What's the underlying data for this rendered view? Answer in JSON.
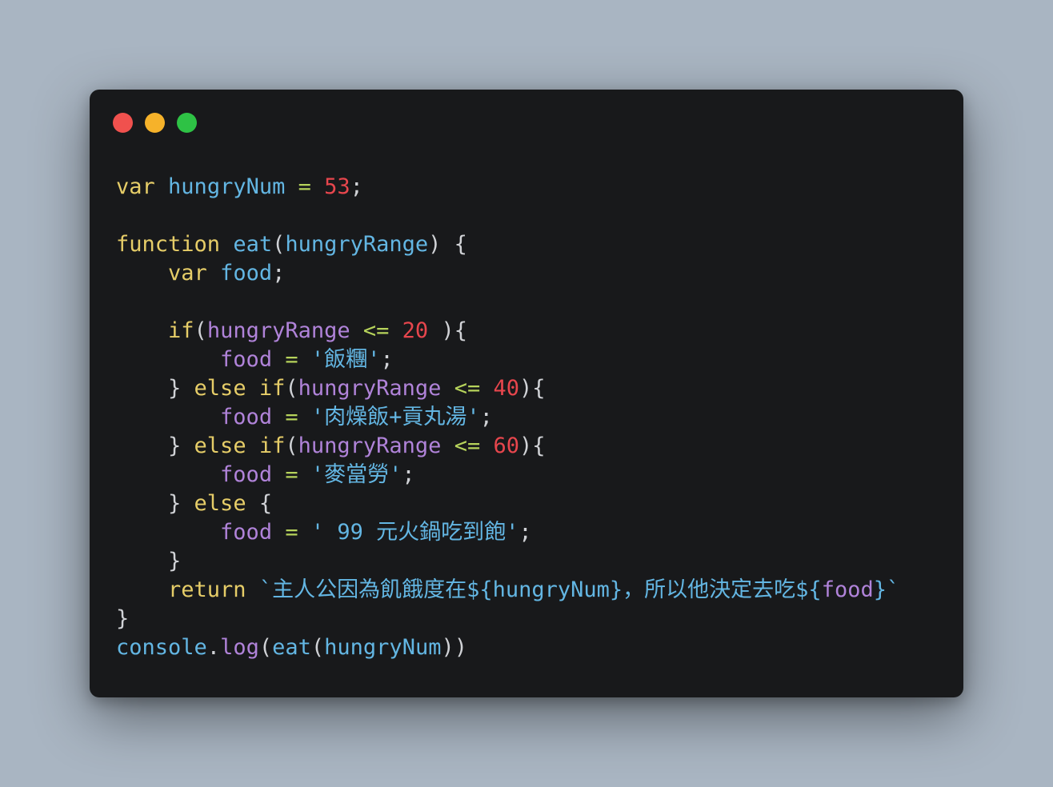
{
  "colors": {
    "background": "#a9b5c2",
    "window": "#18191b",
    "traffic_red": "#f0514e",
    "traffic_yellow": "#f6b22a",
    "traffic_green": "#2ec245",
    "keyword": "#e6cd68",
    "identifier": "#63b6e3",
    "property": "#b083d9",
    "number": "#e7464d",
    "operator": "#b6d35b",
    "punctuation": "#d0d2d6"
  },
  "traffic_lights": [
    "close",
    "minimize",
    "maximize"
  ],
  "code_lines": [
    [
      {
        "t": "var",
        "c": "keyword"
      },
      {
        "t": " ",
        "c": "punctuation"
      },
      {
        "t": "hungryNum",
        "c": "identifier"
      },
      {
        "t": " ",
        "c": "punctuation"
      },
      {
        "t": "=",
        "c": "operator"
      },
      {
        "t": " ",
        "c": "punctuation"
      },
      {
        "t": "53",
        "c": "number"
      },
      {
        "t": ";",
        "c": "punctuation"
      }
    ],
    [],
    [
      {
        "t": "function",
        "c": "keyword"
      },
      {
        "t": " ",
        "c": "punctuation"
      },
      {
        "t": "eat",
        "c": "identifier"
      },
      {
        "t": "(",
        "c": "punctuation"
      },
      {
        "t": "hungryRange",
        "c": "identifier"
      },
      {
        "t": ") {",
        "c": "punctuation"
      }
    ],
    [
      {
        "t": "    ",
        "c": "punctuation"
      },
      {
        "t": "var",
        "c": "keyword"
      },
      {
        "t": " ",
        "c": "punctuation"
      },
      {
        "t": "food",
        "c": "identifier"
      },
      {
        "t": ";",
        "c": "punctuation"
      }
    ],
    [],
    [
      {
        "t": "    ",
        "c": "punctuation"
      },
      {
        "t": "if",
        "c": "keyword"
      },
      {
        "t": "(",
        "c": "punctuation"
      },
      {
        "t": "hungryRange",
        "c": "property"
      },
      {
        "t": " ",
        "c": "punctuation"
      },
      {
        "t": "<=",
        "c": "operator"
      },
      {
        "t": " ",
        "c": "punctuation"
      },
      {
        "t": "20",
        "c": "number"
      },
      {
        "t": " ){",
        "c": "punctuation"
      }
    ],
    [
      {
        "t": "        ",
        "c": "punctuation"
      },
      {
        "t": "food",
        "c": "property"
      },
      {
        "t": " ",
        "c": "punctuation"
      },
      {
        "t": "=",
        "c": "operator"
      },
      {
        "t": " ",
        "c": "punctuation"
      },
      {
        "t": "'飯糰'",
        "c": "identifier"
      },
      {
        "t": ";",
        "c": "punctuation"
      }
    ],
    [
      {
        "t": "    } ",
        "c": "punctuation"
      },
      {
        "t": "else",
        "c": "keyword"
      },
      {
        "t": " ",
        "c": "punctuation"
      },
      {
        "t": "if",
        "c": "keyword"
      },
      {
        "t": "(",
        "c": "punctuation"
      },
      {
        "t": "hungryRange",
        "c": "property"
      },
      {
        "t": " ",
        "c": "punctuation"
      },
      {
        "t": "<=",
        "c": "operator"
      },
      {
        "t": " ",
        "c": "punctuation"
      },
      {
        "t": "40",
        "c": "number"
      },
      {
        "t": "){",
        "c": "punctuation"
      }
    ],
    [
      {
        "t": "        ",
        "c": "punctuation"
      },
      {
        "t": "food",
        "c": "property"
      },
      {
        "t": " ",
        "c": "punctuation"
      },
      {
        "t": "=",
        "c": "operator"
      },
      {
        "t": " ",
        "c": "punctuation"
      },
      {
        "t": "'肉燥飯+貢丸湯'",
        "c": "identifier"
      },
      {
        "t": ";",
        "c": "punctuation"
      }
    ],
    [
      {
        "t": "    } ",
        "c": "punctuation"
      },
      {
        "t": "else",
        "c": "keyword"
      },
      {
        "t": " ",
        "c": "punctuation"
      },
      {
        "t": "if",
        "c": "keyword"
      },
      {
        "t": "(",
        "c": "punctuation"
      },
      {
        "t": "hungryRange",
        "c": "property"
      },
      {
        "t": " ",
        "c": "punctuation"
      },
      {
        "t": "<=",
        "c": "operator"
      },
      {
        "t": " ",
        "c": "punctuation"
      },
      {
        "t": "60",
        "c": "number"
      },
      {
        "t": "){",
        "c": "punctuation"
      }
    ],
    [
      {
        "t": "        ",
        "c": "punctuation"
      },
      {
        "t": "food",
        "c": "property"
      },
      {
        "t": " ",
        "c": "punctuation"
      },
      {
        "t": "=",
        "c": "operator"
      },
      {
        "t": " ",
        "c": "punctuation"
      },
      {
        "t": "'麥當勞'",
        "c": "identifier"
      },
      {
        "t": ";",
        "c": "punctuation"
      }
    ],
    [
      {
        "t": "    } ",
        "c": "punctuation"
      },
      {
        "t": "else",
        "c": "keyword"
      },
      {
        "t": " {",
        "c": "punctuation"
      }
    ],
    [
      {
        "t": "        ",
        "c": "punctuation"
      },
      {
        "t": "food",
        "c": "property"
      },
      {
        "t": " ",
        "c": "punctuation"
      },
      {
        "t": "=",
        "c": "operator"
      },
      {
        "t": " ",
        "c": "punctuation"
      },
      {
        "t": "' 99 元火鍋吃到飽'",
        "c": "identifier"
      },
      {
        "t": ";",
        "c": "punctuation"
      }
    ],
    [
      {
        "t": "    }",
        "c": "punctuation"
      }
    ],
    [
      {
        "t": "    ",
        "c": "punctuation"
      },
      {
        "t": "return",
        "c": "keyword"
      },
      {
        "t": " ",
        "c": "punctuation"
      },
      {
        "t": "`主人公因為飢餓度在${hungryNum}，所以他決定去吃${",
        "c": "identifier"
      },
      {
        "t": "food",
        "c": "property"
      },
      {
        "t": "}`",
        "c": "identifier"
      }
    ],
    [
      {
        "t": "}",
        "c": "punctuation"
      }
    ],
    [
      {
        "t": "console",
        "c": "identifier"
      },
      {
        "t": ".",
        "c": "punctuation"
      },
      {
        "t": "log",
        "c": "property"
      },
      {
        "t": "(",
        "c": "punctuation"
      },
      {
        "t": "eat",
        "c": "identifier"
      },
      {
        "t": "(",
        "c": "punctuation"
      },
      {
        "t": "hungryNum",
        "c": "identifier"
      },
      {
        "t": "))",
        "c": "punctuation"
      }
    ]
  ]
}
